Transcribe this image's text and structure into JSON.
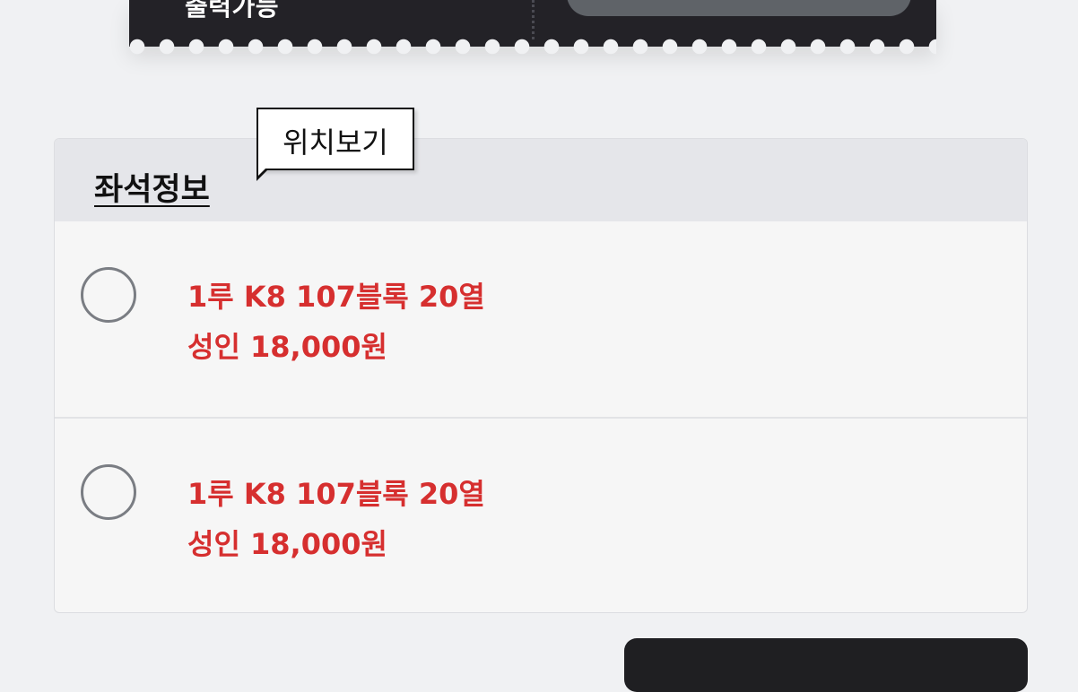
{
  "ticket": {
    "status_label": "출력가능"
  },
  "seat_info": {
    "title": "좌석정보",
    "location_tooltip": "위치보기",
    "options": [
      {
        "seat": "1루 K8 107블록 20열",
        "price": "성인 18,000원"
      },
      {
        "seat": "1루 K8 107블록 20열",
        "price": "성인 18,000원"
      }
    ]
  },
  "colors": {
    "accent_red": "#d62f2f",
    "ticket_dark": "#232227"
  },
  "icons": {
    "radio": "radio-unchecked-icon"
  }
}
